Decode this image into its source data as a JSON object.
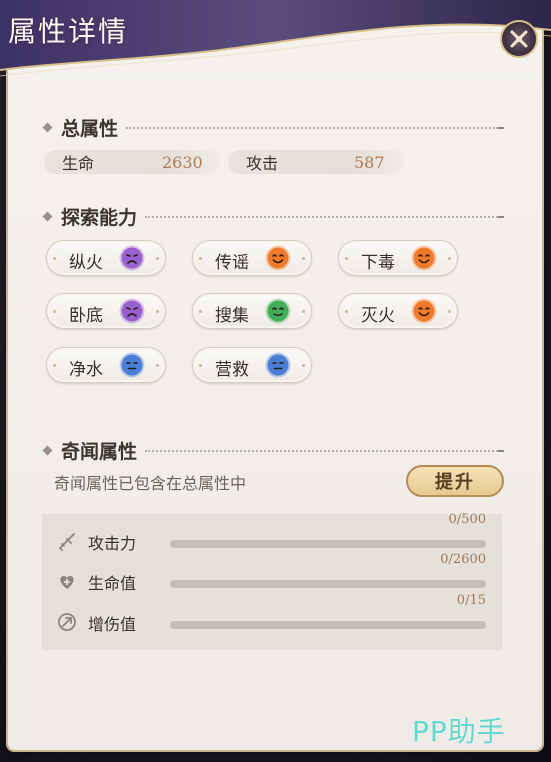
{
  "panel": {
    "title": "属性详情"
  },
  "total_attributes": {
    "title": "总属性",
    "stats": [
      {
        "label": "生命",
        "value": "2630"
      },
      {
        "label": "攻击",
        "value": "587"
      }
    ]
  },
  "exploration": {
    "title": "探索能力",
    "abilities": [
      {
        "label": "纵火",
        "face": "sad-face-icon",
        "color": "#9a5fd0"
      },
      {
        "label": "传谣",
        "face": "happy-face-icon",
        "color": "#f07a2a"
      },
      {
        "label": "下毒",
        "face": "happy-face-icon",
        "color": "#f07a2a"
      },
      {
        "label": "卧底",
        "face": "sad-face-icon",
        "color": "#9a5fd0"
      },
      {
        "label": "搜集",
        "face": "smile-face-icon",
        "color": "#3fae56"
      },
      {
        "label": "灭火",
        "face": "happy-face-icon",
        "color": "#f07a2a"
      },
      {
        "label": "净水",
        "face": "neutral-face-icon",
        "color": "#4a7fd8"
      },
      {
        "label": "营救",
        "face": "neutral-face-icon",
        "color": "#4a7fd8"
      }
    ]
  },
  "qiwen": {
    "title": "奇闻属性",
    "note": "奇闻属性已包含在总属性中",
    "upgrade_label": "提升",
    "bonuses": [
      {
        "label": "攻击力",
        "count": "0/500",
        "progress": 0,
        "icon": "sword-icon"
      },
      {
        "label": "生命值",
        "count": "0/2600",
        "progress": 0,
        "icon": "heart-plus-icon"
      },
      {
        "label": "增伤值",
        "count": "0/15",
        "progress": 0,
        "icon": "damage-boost-icon"
      }
    ]
  },
  "watermark": {
    "text": "PP助手"
  },
  "colors": {
    "accent": "#c7a26c",
    "stat_value": "#b07a52",
    "panel_bg": "#f2efeb"
  }
}
